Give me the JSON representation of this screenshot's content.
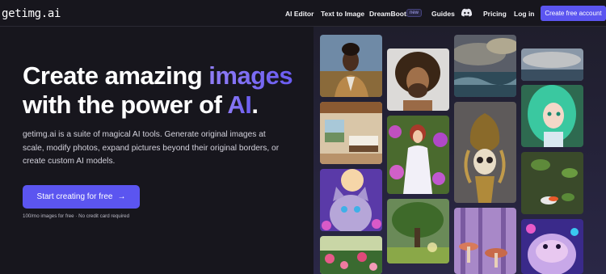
{
  "nav": {
    "logo": "getimg.ai",
    "links": [
      "AI Editor",
      "Text to Image",
      "DreamBooth",
      "Guides",
      "Pricing",
      "Log in"
    ],
    "new_badge": "new",
    "cta": "Create free account"
  },
  "hero": {
    "title_line1_a": "Create amazing ",
    "title_line1_b": "images",
    "title_line2_a": "with the power of ",
    "title_line2_b": "AI",
    "title_line2_c": ".",
    "description": "getimg.ai is a suite of magical AI tools. Generate original images at scale, modify photos, expand pictures beyond their original borders, or create custom AI models.",
    "cta": "Start creating for free",
    "cta_arrow": "→",
    "subtext": "100/mo images for free · No credit card required"
  },
  "gallery": {
    "tiles": [
      "portrait-man-suit",
      "interior-bedroom",
      "cat-fantasy",
      "roses-garden",
      "curly-hair-man",
      "goddess-flowers",
      "tree-field",
      "stormy-sea",
      "golden-skull",
      "mushroom-forest",
      "cloud-ocean",
      "green-hair-girl",
      "koi-pond",
      "hamster-neon"
    ]
  },
  "colors": {
    "accent": "#5b55f0",
    "background": "#17161d"
  }
}
